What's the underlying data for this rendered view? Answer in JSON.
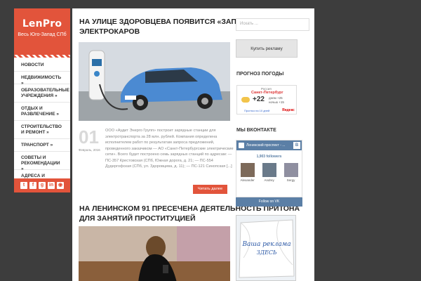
{
  "logo": {
    "name": "LenPro",
    "subtitle": "Весь Юго-Запад СПб"
  },
  "nav": [
    {
      "label": "НОВОСТИ"
    },
    {
      "label": "НЕДВИЖИМОСТЬ »"
    },
    {
      "label": "ОБРАЗОВАТЕЛЬНЫЕ УЧРЕЖДЕНИЯ »"
    },
    {
      "label": "ОТДЫХ И РАЗВЛЕЧЕНИЕ »"
    },
    {
      "label": "СТРОИТЕЛЬСТВО И РЕМОНТ »"
    },
    {
      "label": "ТРАНСПОРТ »"
    },
    {
      "label": "СОВЕТЫ И РЕКОМЕНДАЦИИ »"
    },
    {
      "label": "АДРЕСА И ТЕЛЕФОНЫ »"
    }
  ],
  "social": [
    "twitter-icon",
    "facebook-icon",
    "google-plus-icon",
    "linkedin-icon",
    "rss-icon"
  ],
  "post1": {
    "title": "На улице Здоровцева появится «заправка» для электрокаров",
    "day": "01",
    "month_year": "Февраль, 2016",
    "excerpt": "ООО «Аудит Энерго Групп» построит зарядные станции для электротранспорта за 28 млн. рублей. Компания определена исполнителем работ по результатам запроса предложений, проведенного заказчиком — АО «Санкт-Петербургские электрические сети». Всего будет построено семь зарядных станций по адресам: — ПС-357 Крестовская (СПб, Южная дорога, д. 21; — ПС-554 Дудергофская (СПб, ул. Здоровцева, д. 11); — ПС-121 Синопская [...]",
    "more_label": "Читать далее"
  },
  "post2": {
    "title": "На Ленинском 91 пресечена деятельность притона для занятий проституцией"
  },
  "sidebar": {
    "search_placeholder": "Искать ...",
    "ad_button": "Купить рекламу",
    "weather_title": "ПРОГНОЗ ПОГОДЫ",
    "weather": {
      "country": "Россия",
      "city": "Санкт-Петербург",
      "temp": "+22",
      "day": "днем +25",
      "night": "ночью +15",
      "link": "Прогноз на 10 дней",
      "provider": "Яндекс"
    },
    "vk_title": "МЫ ВКОНТАКТЕ",
    "vk": {
      "group": "Ленинский проспект - ...",
      "followers": "1,903 followers",
      "members": [
        "Alexander",
        "Andrey",
        "Sergy"
      ],
      "follow": "Follow on VK"
    },
    "banner": {
      "line1": "Ваша реклама",
      "line2": "ЗДЕСЬ"
    }
  },
  "colors": {
    "accent": "#e2543b",
    "vk": "#5b7fa6"
  }
}
